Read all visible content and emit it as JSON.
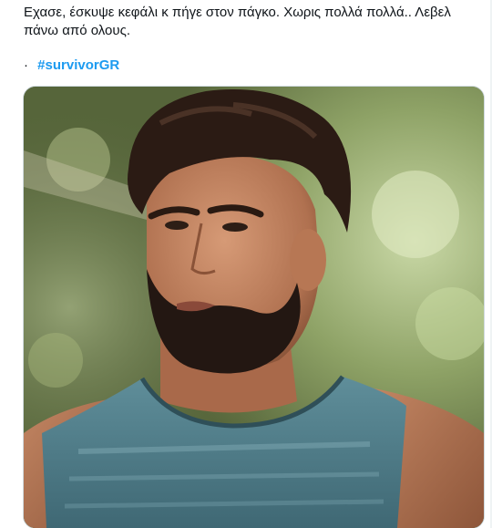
{
  "tweet": {
    "text_line_1": "Εχασε, έσκυψε κεφάλι κ πήγε στον πάγκο. Χωρις πολλά πολλά.. Λεβελ",
    "text_line_2": "πάνω από ολους.",
    "bullet": "·",
    "hashtag": "#survivorGR"
  },
  "media": {
    "kind": "photo",
    "subject": "portrait of bearded man in sleeveless teal top, green blurred background"
  },
  "colors": {
    "text": "#0f1419",
    "hashtag": "#1d9bf0",
    "media_border": "#cfd9de"
  }
}
